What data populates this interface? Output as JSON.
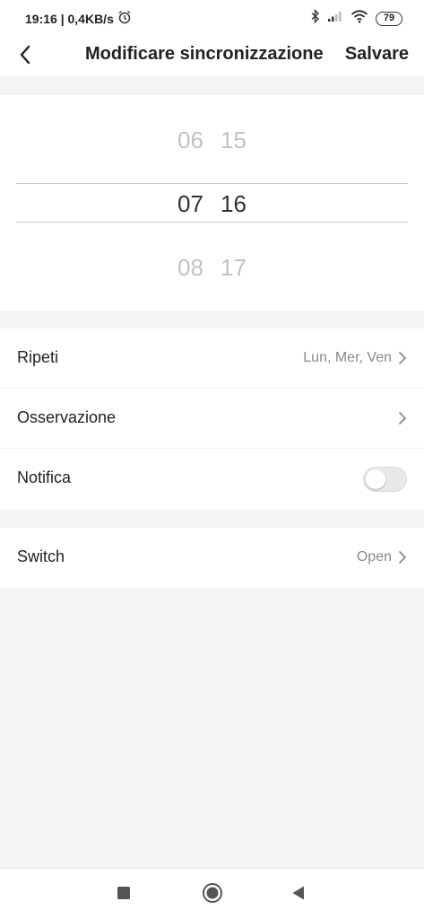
{
  "status_bar": {
    "time_speed": "19:16 | 0,4KB/s",
    "battery": "79",
    "icons": [
      "alarm-icon",
      "bluetooth-icon",
      "signal-icon",
      "wifi-icon",
      "battery-icon"
    ]
  },
  "header": {
    "title": "Modificare sincronizzazione",
    "save_label": "Salvare",
    "back_icon": "chevron-left-icon"
  },
  "time_picker": {
    "prev": {
      "hour": "06",
      "minute": "15"
    },
    "selected": {
      "hour": "07",
      "minute": "16"
    },
    "next": {
      "hour": "08",
      "minute": "17"
    }
  },
  "settings": {
    "repeat": {
      "label": "Ripeti",
      "value": "Lun, Mer, Ven"
    },
    "note": {
      "label": "Osservazione"
    },
    "notification": {
      "label": "Notifica",
      "enabled": false
    },
    "switch": {
      "label": "Switch",
      "value": "Open"
    }
  },
  "nav_bar": {
    "icons": [
      "recent-apps-icon",
      "home-icon",
      "back-icon"
    ]
  },
  "colors": {
    "background": "#f4f4f4",
    "surface": "#ffffff",
    "text_primary": "#222222",
    "text_secondary": "#8a8a8a",
    "picker_faded": "#c2c2c2"
  }
}
